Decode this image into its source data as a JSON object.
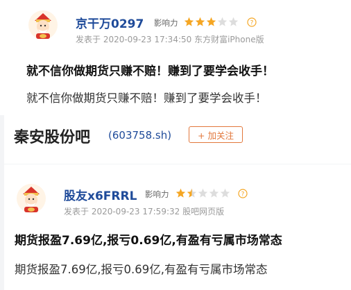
{
  "posts": [
    {
      "username": "京干万0297",
      "influence_label": "影响力",
      "influence_stars": 3,
      "max_stars": 5,
      "meta": "发表于 2020-09-23 17:34:50 东方财富iPhone版",
      "title": "就不信你做期货只赚不赔！赚到了要学会收手！",
      "body": "就不信你做期货只赚不赔！赚到了要学会收手！"
    },
    {
      "username": "股友x6FRRL",
      "influence_label": "影响力",
      "influence_stars": 1.5,
      "max_stars": 5,
      "meta": "发表于 2020-09-23 17:59:32 股吧网页版",
      "title": "期货报盈7.69亿,报亏0.69亿,有盈有亏属市场常态",
      "body": "期货报盈7.69亿,报亏0.69亿,有盈有亏属市场常态"
    }
  ],
  "bar": {
    "name": "秦安股份吧",
    "code": "(603758.sh)",
    "follow_label": "+ 加关注"
  },
  "colors": {
    "star_filled": "#f5a623",
    "star_empty": "#dddddd",
    "help": "#f5a623",
    "accent": "#e2773b",
    "username": "#1f4b9a"
  }
}
